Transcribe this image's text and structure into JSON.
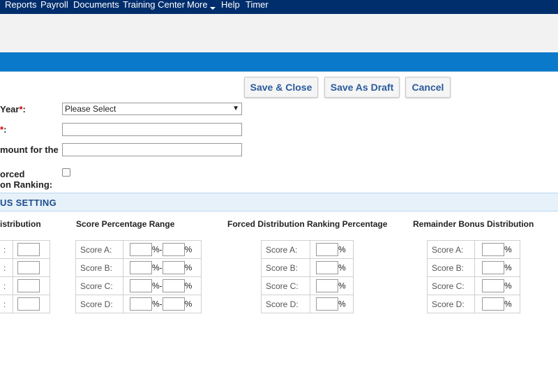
{
  "nav": {
    "items": [
      "Reports",
      "Payroll",
      "Documents",
      "Training Center",
      "More",
      "Help",
      "Timer"
    ]
  },
  "toolbar": {
    "save_close": "Save & Close",
    "save_draft": "Save As Draft",
    "cancel": "Cancel"
  },
  "form": {
    "year_label": "Year",
    "year_select_value": "Please Select",
    "second_label": "",
    "amount_label": "mount for the",
    "forced_label_line1": "orced",
    "forced_label_line2": "on Ranking:",
    "required_mark": "*",
    "colon": ":"
  },
  "section": {
    "title": "US SETTING"
  },
  "columns": {
    "distribution": "istribution",
    "score_range": "Score Percentage Range",
    "forced_pct": "Forced Distribution Ranking Percentage",
    "remainder": "Remainder Bonus Distribution"
  },
  "score_labels": [
    "Score A:",
    "Score B:",
    "Score C:",
    "Score D:"
  ],
  "cut_label": ":",
  "percent": "%",
  "range_sep": "%-",
  "colors": {
    "nav_bg": "#002e6d",
    "accent_bar": "#0a79c9",
    "section_bg": "#e6f1fa",
    "section_text": "#1f4e8c",
    "button_text": "#2a5b9c",
    "required": "#d00000"
  }
}
